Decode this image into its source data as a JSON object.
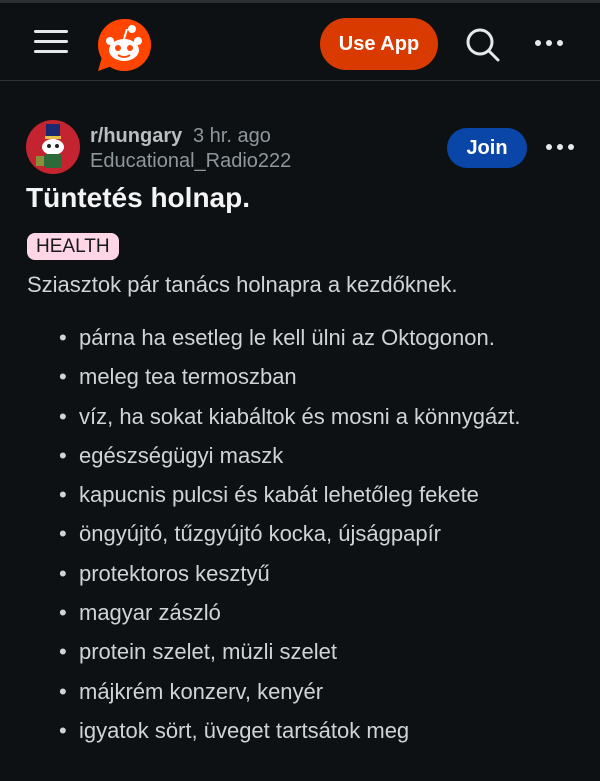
{
  "header": {
    "menu_icon": "hamburger-menu-icon",
    "logo_icon": "reddit-logo-icon",
    "use_app_label": "Use App",
    "search_icon": "search-icon",
    "more_icon": "more-horizontal-icon",
    "accent": "#d93a00"
  },
  "post": {
    "subreddit": "r/hungary",
    "time_ago": "3 hr. ago",
    "author": "Educational_Radio222",
    "join_label": "Join",
    "join_color": "#0a45a8",
    "title": "Tüntetés holnap.",
    "flair": "HEALTH",
    "flair_color": "#ffd6e5",
    "intro": "Sziasztok pár tanács holnapra a kezdőknek.",
    "items": [
      "párna ha esetleg le kell ülni az Oktogonon.",
      "meleg tea termoszban",
      "víz, ha sokat kiabáltok és mosni a könnygázt.",
      "egészségügyi maszk",
      "kapucnis pulcsi és kabát lehetőleg fekete",
      "öngyújtó, tűzgyújtó kocka, újságpapír",
      "protektoros kesztyű",
      "magyar zászló",
      "protein szelet, müzli szelet",
      "májkrém konzerv, kenyér",
      "igyatok sört, üveget tartsátok meg"
    ]
  }
}
